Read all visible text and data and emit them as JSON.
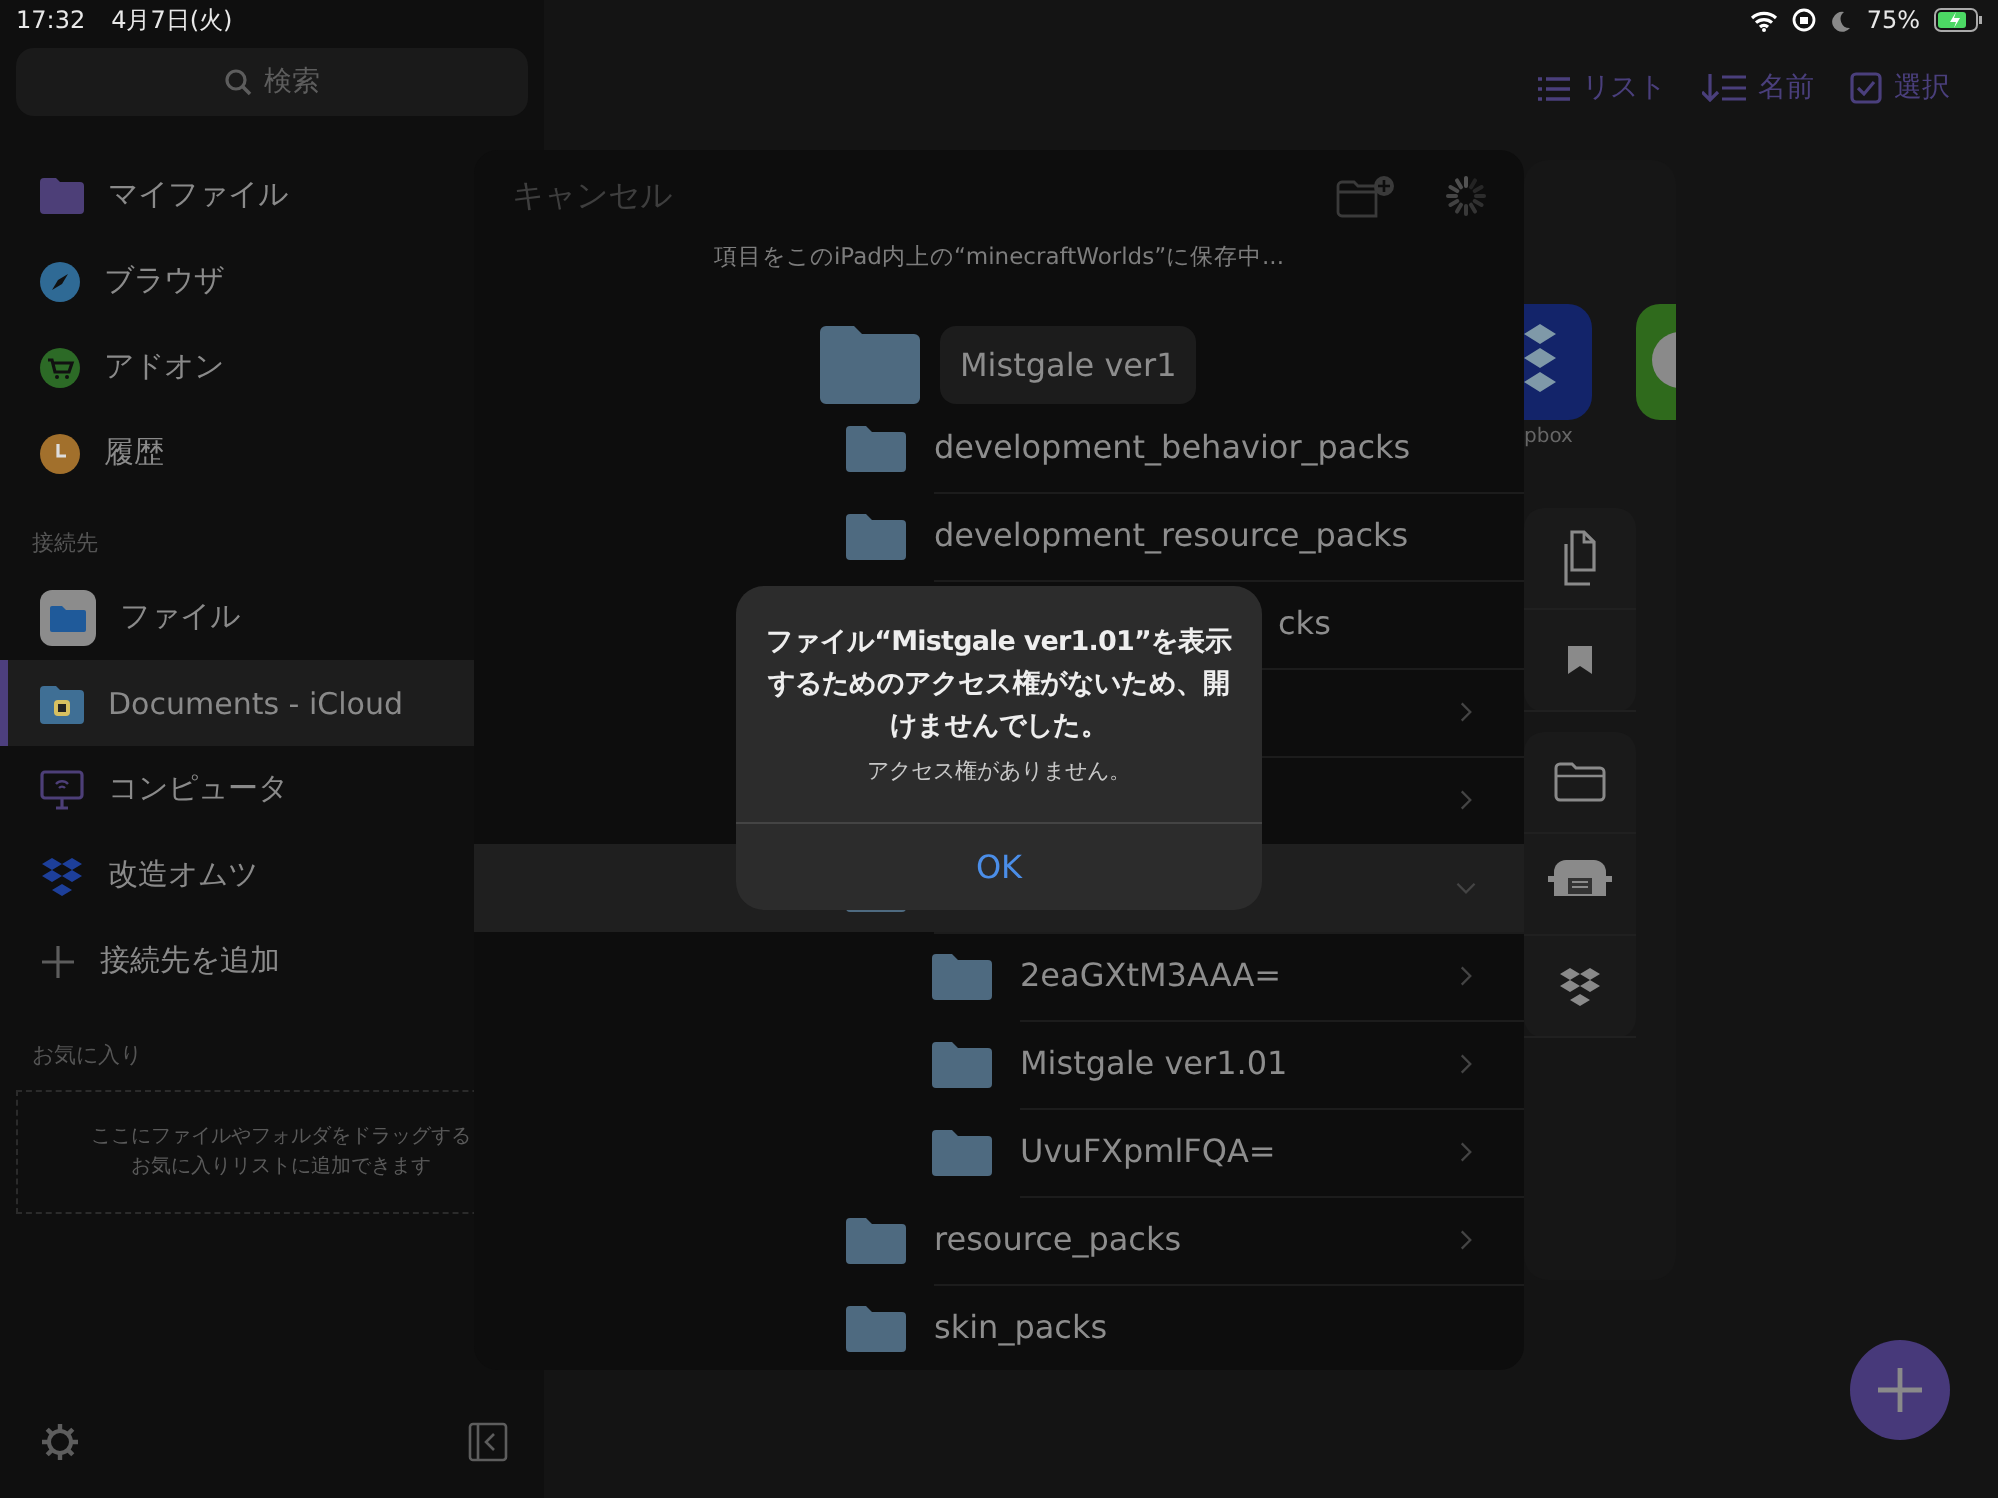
{
  "status_bar": {
    "time": "17:32",
    "date": "4月7日(火)",
    "battery": "75%"
  },
  "sidebar": {
    "search": {
      "placeholder": "検索"
    },
    "items": [
      {
        "label": "マイファイル",
        "selected": false
      },
      {
        "label": "ブラウザ",
        "selected": false
      },
      {
        "label": "アドオン",
        "selected": false
      },
      {
        "label": "履歴",
        "selected": false
      }
    ],
    "connections_title": "接続先",
    "connections": [
      {
        "label": "ファイル",
        "selected": false
      },
      {
        "label": "Documents - iCloud",
        "selected": true
      },
      {
        "label": "コンピュータ",
        "selected": false
      },
      {
        "label": "改造オムツ",
        "selected": false
      },
      {
        "label": "接続先を追加",
        "selected": false
      }
    ],
    "favorites_title": "お気に入り",
    "favorites_hint": [
      "ここにファイルやフォルダをドラッグする",
      "お気に入りリストに追加できます"
    ]
  },
  "toolbar": [
    {
      "label": "リスト"
    },
    {
      "label": "名前"
    },
    {
      "label": "選択"
    }
  ],
  "app_label": "pbox",
  "sheet": {
    "cancel": "キャンセル",
    "subtitle": "項目をこのiPad内上の“minecraftWorlds”に保存中...",
    "dragged": "Mistgale ver1",
    "rows": [
      {
        "kind": "named",
        "name": "development_behavior_packs",
        "selected": false
      },
      {
        "kind": "named",
        "name": "development_resource_packs",
        "selected": false
      },
      {
        "kind": "fragment",
        "name": "cks",
        "selected": false
      },
      {
        "kind": "covered",
        "expanded": false,
        "selected": false
      },
      {
        "kind": "covered",
        "expanded": false,
        "selected": false
      },
      {
        "kind": "icon-only",
        "expanded": true,
        "selected": true,
        "children": [
          {
            "kind": "named",
            "name": "2eaGXtM3AAA=",
            "expanded": false,
            "selected": false
          },
          {
            "kind": "named",
            "name": "Mistgale ver1.01",
            "expanded": false,
            "selected": false
          },
          {
            "kind": "named",
            "name": "UvuFXpmlFQA=",
            "expanded": false,
            "selected": false
          }
        ]
      },
      {
        "kind": "named",
        "name": "resource_packs",
        "expanded": false,
        "selected": false
      },
      {
        "kind": "named",
        "name": "skin_packs",
        "selected": false
      }
    ]
  },
  "alert": {
    "title": "ファイル“Mistgale ver1.01”を表示するためのアクセス権がないため、開けませんでした。",
    "message": "アクセス権がありません。",
    "button": "OK"
  }
}
